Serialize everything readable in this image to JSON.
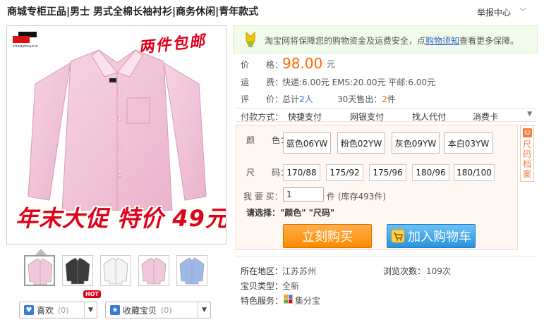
{
  "header": {
    "title": "商城专柜正品|男士 男式全棉长袖衬衫|商务休闲|青年款式",
    "report_label": "举报中心",
    "report_arrow_icon": "chevron-down-icon"
  },
  "gallery": {
    "logo_text": "cheapmania",
    "badge_text": "两件包邮",
    "promo_text": "年末大促 特价 49元",
    "thumbnails": [
      {
        "color": "#f2c6dc"
      },
      {
        "color": "#3a3a3a"
      },
      {
        "color": "#f4f4f4"
      },
      {
        "color": "#f2c6dc"
      },
      {
        "color": "#9fb8e6"
      }
    ],
    "thumb_badge": "HOT",
    "like_label": "喜欢",
    "like_count": "(0)",
    "fav_label": "收藏宝贝",
    "fav_count": "(0)"
  },
  "notice": {
    "text_before": "淘宝网将保障您的购物资金及运费安全，点",
    "link_text": "购物须知",
    "text_after": "查看更多保障。"
  },
  "details": {
    "price_label": "价　　格：",
    "price_value": "98.00",
    "price_unit": "元",
    "shipping_label": "运　　费：",
    "shipping_value": "快递:6.00元 EMS:20.00元 平邮:6.00元",
    "rating_label": "评　　价：",
    "rating_prefix": "总计",
    "rating_count": "2人",
    "sold_label": "30天售出：",
    "sold_count": "2",
    "sold_unit": "件"
  },
  "payment": {
    "label": "付款方式：",
    "methods": [
      "快捷支付",
      "网银支付",
      "找人代付",
      "消费卡"
    ]
  },
  "sku": {
    "color_label": "颜　　色：",
    "colors": [
      "蓝色06YW",
      "粉色02YW",
      "灰色09YW",
      "本白03YW"
    ],
    "size_label": "尺　　码：",
    "sizes": [
      "170/88",
      "175/92",
      "175/96",
      "180/96",
      "180/100"
    ],
    "qty_label": "我 要 买：",
    "qty_value": "1",
    "qty_unit": "件 (库存493件)",
    "choose_text": "请选择：\"颜色\" \"尺码\"",
    "buy_label": "立刻购买",
    "cart_label": "加入购物车",
    "size_chart_text": "尺码档案"
  },
  "meta": {
    "location_label": "所在地区：",
    "location_value": "江苏苏州",
    "views_label": "浏览次数：",
    "views_value": "109次",
    "type_label": "宝贝类型：",
    "type_value": "全新",
    "service_label": "特色服务：",
    "service_value": "集分宝"
  },
  "colors": {
    "accent_orange": "#ff6600",
    "link_blue": "#3366cc",
    "promo_red": "#e0001b"
  }
}
